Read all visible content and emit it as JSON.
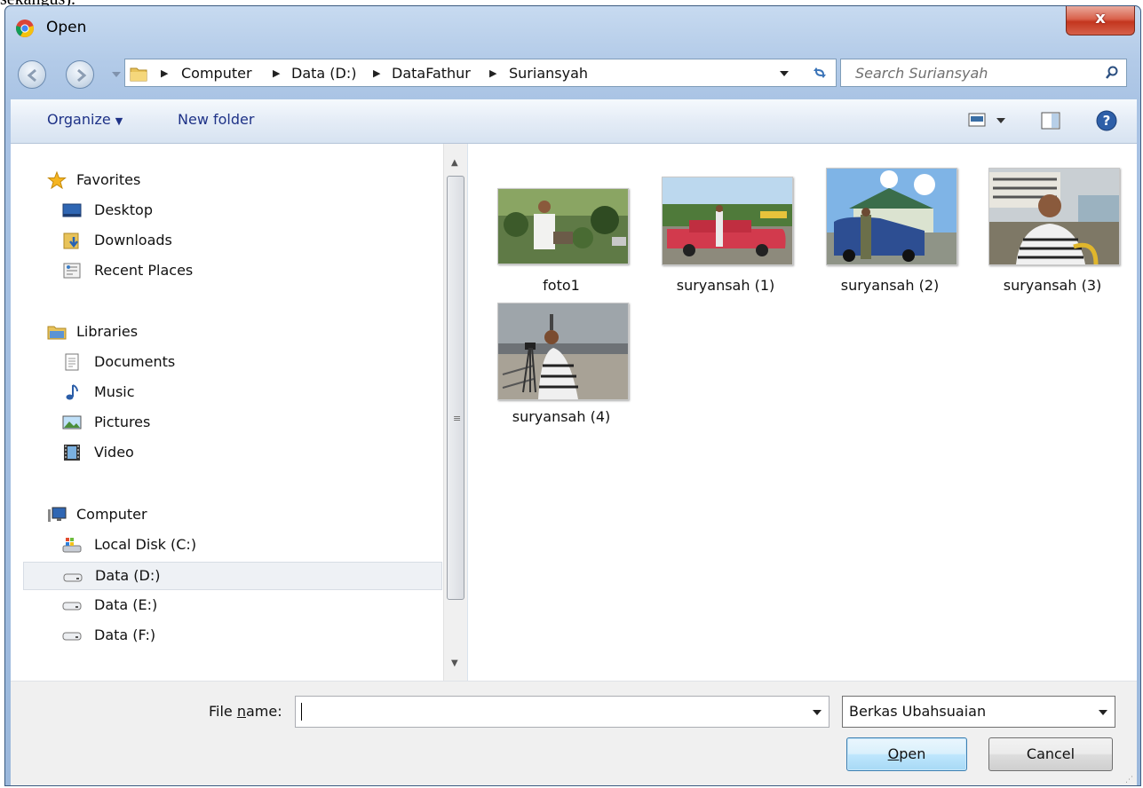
{
  "background_text": "sekangus).",
  "window": {
    "title": "Open",
    "close_label": "x"
  },
  "nav": {
    "breadcrumb": [
      "Computer",
      "Data (D:)",
      "DataFathur",
      "Suriansyah"
    ],
    "search_placeholder": "Search Suriansyah"
  },
  "toolbar": {
    "organize": "Organize",
    "new_folder": "New folder"
  },
  "sidebar": {
    "favorites": {
      "label": "Favorites",
      "items": [
        "Desktop",
        "Downloads",
        "Recent Places"
      ]
    },
    "libraries": {
      "label": "Libraries",
      "items": [
        "Documents",
        "Music",
        "Pictures",
        "Video"
      ]
    },
    "computer": {
      "label": "Computer",
      "items": [
        "Local Disk (C:)",
        "Data (D:)",
        "Data (E:)",
        "Data (F:)"
      ]
    },
    "selected": "Data (D:)"
  },
  "files": [
    {
      "name": "foto1"
    },
    {
      "name": "suryansah (1)"
    },
    {
      "name": "suryansah (2)"
    },
    {
      "name": "suryansah (3)"
    },
    {
      "name": "suryansah (4)"
    }
  ],
  "footer": {
    "file_name_label_pre": "File ",
    "file_name_label_u": "n",
    "file_name_label_post": "ame:",
    "file_name_value": "",
    "file_type": "Berkas Ubahsuaian",
    "open_u": "O",
    "open_rest": "pen",
    "cancel": "Cancel"
  }
}
